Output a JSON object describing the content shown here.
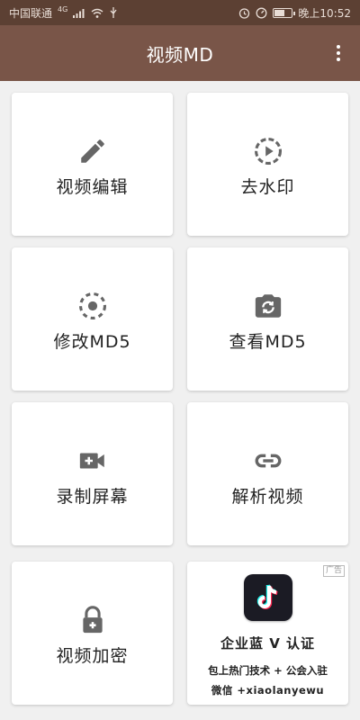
{
  "status_bar": {
    "carrier": "中国联通",
    "signal_label": "4G",
    "time": "晚上10:52"
  },
  "app_bar": {
    "title": "视频MD",
    "menu_icon": "more-vert-icon"
  },
  "features": [
    {
      "label": "视频编辑",
      "icon": "pencil-icon"
    },
    {
      "label": "去水印",
      "icon": "play-circle-dashed-icon"
    },
    {
      "label": "修改MD5",
      "icon": "target-dashed-icon"
    },
    {
      "label": "查看MD5",
      "icon": "camera-switch-icon"
    },
    {
      "label": "录制屏幕",
      "icon": "video-add-icon"
    },
    {
      "label": "解析视频",
      "icon": "link-icon"
    },
    {
      "label": "视频加密",
      "icon": "lock-icon"
    }
  ],
  "ad": {
    "badge": "广告",
    "line1": "企业蓝 V 认证",
    "line2": "包上热门技术 + 公会入驻",
    "line3": "微信 +xiaolanyewu",
    "logo_icon": "tiktok-icon"
  },
  "colors": {
    "status_bar": "#5c4033",
    "app_bar": "#795548",
    "background": "#f0f0f0",
    "icon": "#666666"
  }
}
